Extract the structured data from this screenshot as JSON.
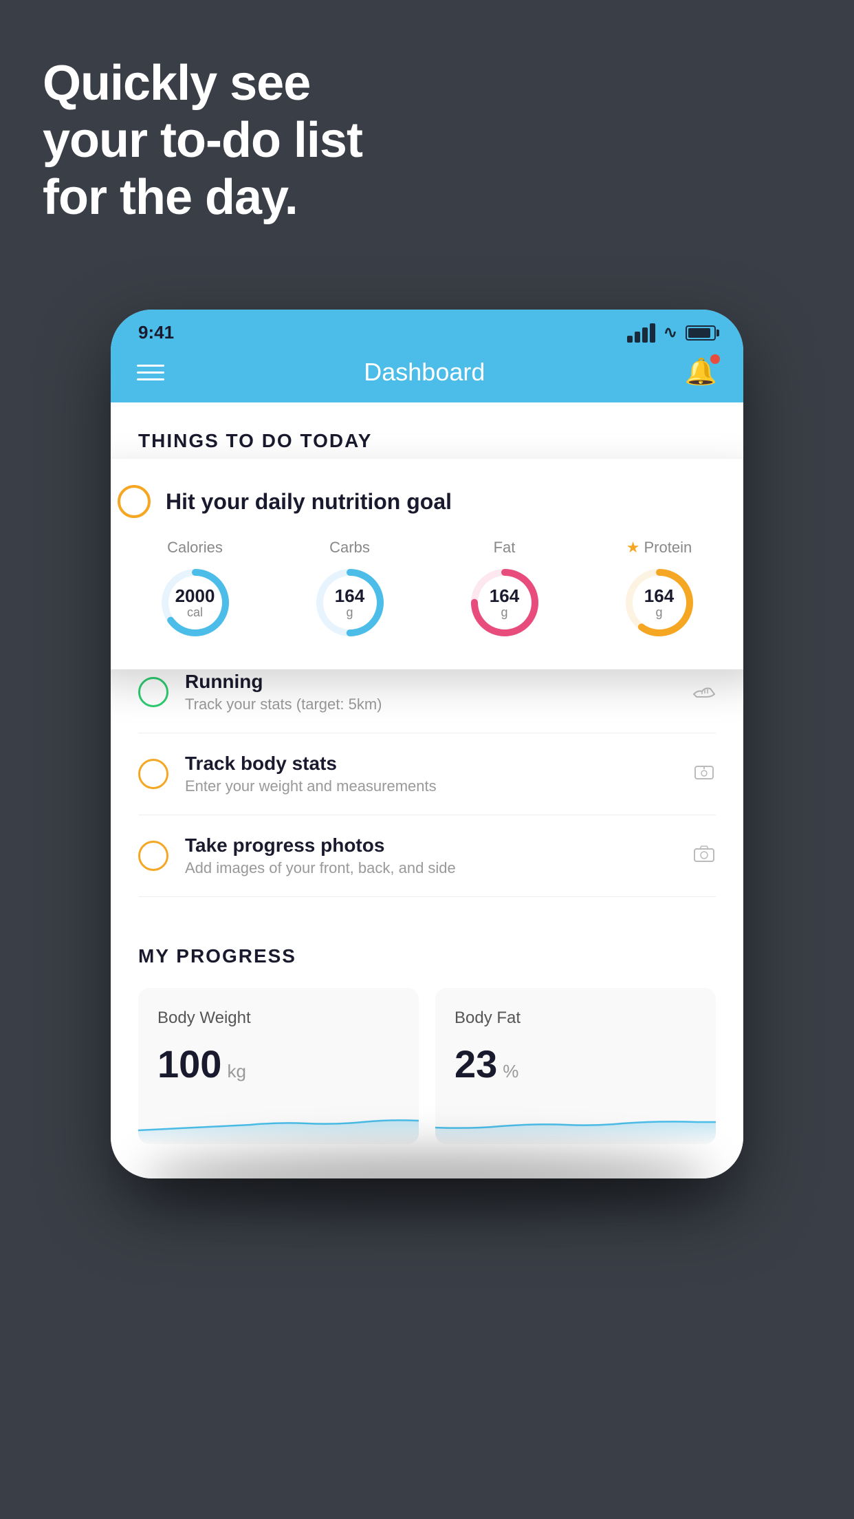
{
  "hero": {
    "line1": "Quickly see",
    "line2": "your to-do list",
    "line3": "for the day."
  },
  "phone": {
    "status_bar": {
      "time": "9:41"
    },
    "nav": {
      "title": "Dashboard"
    },
    "things_section": {
      "header": "THINGS TO DO TODAY"
    },
    "floating_card": {
      "title": "Hit your daily nutrition goal",
      "nutrition": [
        {
          "label": "Calories",
          "value": "2000",
          "unit": "cal",
          "color": "#4bbde8",
          "progress": 0.65,
          "starred": false
        },
        {
          "label": "Carbs",
          "value": "164",
          "unit": "g",
          "color": "#4bbde8",
          "progress": 0.5,
          "starred": false
        },
        {
          "label": "Fat",
          "value": "164",
          "unit": "g",
          "color": "#e74c7c",
          "progress": 0.75,
          "starred": false
        },
        {
          "label": "Protein",
          "value": "164",
          "unit": "g",
          "color": "#f5a623",
          "progress": 0.6,
          "starred": true
        }
      ]
    },
    "todo_items": [
      {
        "id": "running",
        "title": "Running",
        "subtitle": "Track your stats (target: 5km)",
        "circle_color": "green",
        "icon": "👟"
      },
      {
        "id": "body-stats",
        "title": "Track body stats",
        "subtitle": "Enter your weight and measurements",
        "circle_color": "yellow",
        "icon": "⚖"
      },
      {
        "id": "progress-photos",
        "title": "Take progress photos",
        "subtitle": "Add images of your front, back, and side",
        "circle_color": "yellow",
        "icon": "🖼"
      }
    ],
    "progress_section": {
      "header": "MY PROGRESS",
      "cards": [
        {
          "id": "body-weight",
          "title": "Body Weight",
          "value": "100",
          "unit": "kg"
        },
        {
          "id": "body-fat",
          "title": "Body Fat",
          "value": "23",
          "unit": "%"
        }
      ]
    }
  }
}
